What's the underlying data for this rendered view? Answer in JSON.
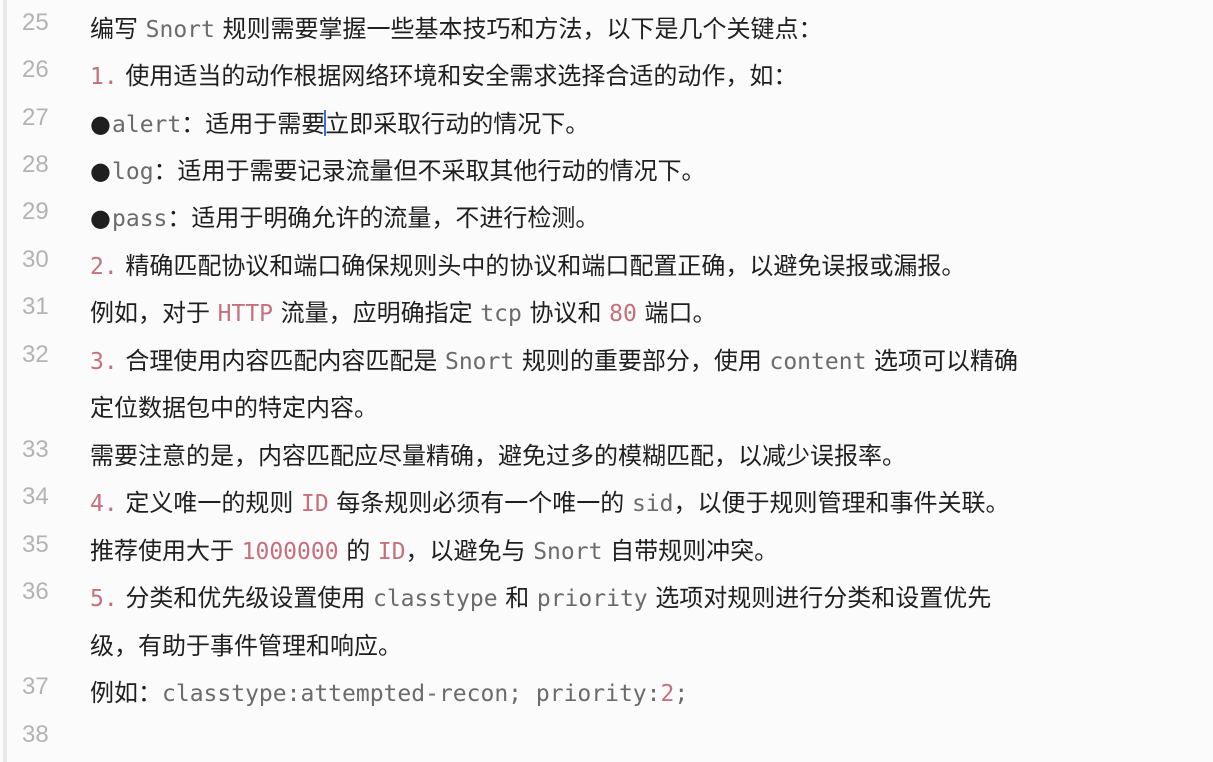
{
  "lines": {
    "l25": {
      "num": "25",
      "text": "编写 Snort 规则需要掌握一些基本技巧和方法，以下是几个关键点："
    },
    "l26": {
      "num": "26",
      "marker": "1.",
      "text": " 使用适当的动作根据网络环境和安全需求选择合适的动作，如："
    },
    "l27": {
      "num": "27",
      "code": "alert",
      "text_a": "：适用于需要",
      "text_b": "立即采取行动的情况下。"
    },
    "l28": {
      "num": "28",
      "code": "log",
      "text": "：适用于需要记录流量但不采取其他行动的情况下。"
    },
    "l29": {
      "num": "29",
      "code": "pass",
      "text": "：适用于明确允许的流量，不进行检测。"
    },
    "l30": {
      "num": "30",
      "marker": "2.",
      "text": " 精确匹配协议和端口确保规则头中的协议和端口配置正确，以避免误报或漏报。"
    },
    "l31": {
      "num": "31",
      "t1": "例如，对于 ",
      "hl1": "HTTP",
      "t2": " 流量，应明确指定 ",
      "code": "tcp",
      "t3": " 协议和 ",
      "hl2": "80",
      "t4": " 端口。"
    },
    "l32": {
      "num": "32",
      "marker": "3.",
      "t1": " 合理使用内容匹配内容匹配是 ",
      "code1": "Snort",
      "t2": " 规则的重要部分，使用 ",
      "code2": "content",
      "t3": " 选项可以精确",
      "wrap": "定位数据包中的特定内容。"
    },
    "l33": {
      "num": "33",
      "text": "需要注意的是，内容匹配应尽量精确，避免过多的模糊匹配，以减少误报率。"
    },
    "l34": {
      "num": "34",
      "marker": "4.",
      "t1": " 定义唯一的规则 ",
      "hl": "ID",
      "t2": " 每条规则必须有一个唯一的 ",
      "code": "sid",
      "t3": "，以便于规则管理和事件关联。"
    },
    "l35": {
      "num": "35",
      "t1": "推荐使用大于 ",
      "hl1": "1000000",
      "t2": " 的 ",
      "hl2": "ID",
      "t3": "，以避免与 ",
      "code": "Snort",
      "t4": " 自带规则冲突。"
    },
    "l36": {
      "num": "36",
      "marker": "5.",
      "t1": " 分类和优先级设置使用 ",
      "code1": "classtype",
      "t2": " 和 ",
      "code2": "priority",
      "t3": " 选项对规则进行分类和设置优先",
      "wrap": "级，有助于事件管理和响应。"
    },
    "l37": {
      "num": "37",
      "t1": "例如：",
      "code1": "classtype:attempted-recon; priority:",
      "hl": "2",
      "code2": ";"
    },
    "l38": {
      "num": "38"
    }
  },
  "colors": {
    "code": "#6b6b6b",
    "highlight": "#c5707c",
    "gutter": "#b3b3b3",
    "caret": "#3b6fd9"
  },
  "snort_word": "Snort"
}
